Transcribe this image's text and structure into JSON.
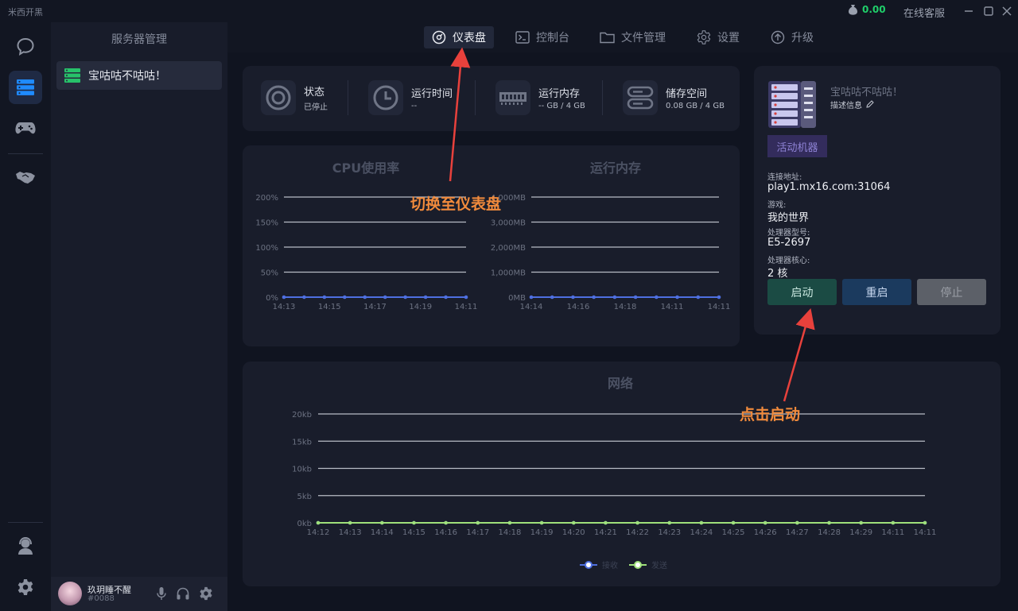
{
  "app": {
    "title": "米西开黑",
    "balance": "0.00",
    "support": "在线客服"
  },
  "sidebar": {
    "panel_title": "服务器管理",
    "server_name": "宝咕咕不咕咕！"
  },
  "user": {
    "name": "玖玥睡不醒",
    "id": "#0088"
  },
  "nav": {
    "tabs": [
      {
        "label": "仪表盘",
        "active": true
      },
      {
        "label": "控制台"
      },
      {
        "label": "文件管理"
      },
      {
        "label": "设置"
      },
      {
        "label": "升级"
      }
    ]
  },
  "stats": [
    {
      "label": "状态",
      "value": "已停止"
    },
    {
      "label": "运行时间",
      "value": "--"
    },
    {
      "label": "运行内存",
      "value": "-- GB / 4 GB"
    },
    {
      "label": "储存空间",
      "value": "0.08 GB / 4 GB"
    }
  ],
  "chart_data": [
    {
      "type": "line",
      "title": "CPU使用率",
      "x": [
        "14:13",
        "14:15",
        "14:17",
        "14:19",
        "14:11"
      ],
      "yticks": [
        "0%",
        "50%",
        "100%",
        "150%",
        "200%"
      ],
      "ylim": [
        0,
        200
      ],
      "series": [
        {
          "values": [
            0,
            0,
            0,
            0,
            0,
            0,
            0,
            0,
            0,
            0
          ],
          "color": "#4e6fe0"
        }
      ]
    },
    {
      "type": "line",
      "title": "运行内存",
      "x": [
        "14:14",
        "14:16",
        "14:18",
        "14:11",
        "14:11"
      ],
      "yticks": [
        "0MB",
        "1,000MB",
        "2,000MB",
        "3,000MB",
        "4,000MB"
      ],
      "ylim": [
        0,
        4000
      ],
      "series": [
        {
          "values": [
            0,
            0,
            0,
            0,
            0,
            0,
            0,
            0,
            0,
            0
          ],
          "color": "#4e6fe0"
        }
      ]
    },
    {
      "type": "line",
      "title": "网络",
      "x": [
        "14:12",
        "14:13",
        "14:14",
        "14:15",
        "14:16",
        "14:17",
        "14:18",
        "14:19",
        "14:20",
        "14:21",
        "14:22",
        "14:23",
        "14:24",
        "14:25",
        "14:26",
        "14:27",
        "14:28",
        "14:29",
        "14:11",
        "14:11"
      ],
      "yticks": [
        "0kb",
        "5kb",
        "10kb",
        "15kb",
        "20kb"
      ],
      "ylim": [
        0,
        20
      ],
      "series": [
        {
          "name": "接收",
          "values": [
            0,
            0,
            0,
            0,
            0,
            0,
            0,
            0,
            0,
            0,
            0,
            0,
            0,
            0,
            0,
            0,
            0,
            0,
            0,
            0
          ],
          "color": "#4e6fe0"
        },
        {
          "name": "发送",
          "values": [
            0,
            0,
            0,
            0,
            0,
            0,
            0,
            0,
            0,
            0,
            0,
            0,
            0,
            0,
            0,
            0,
            0,
            0,
            0,
            0
          ],
          "color": "#9fe07a"
        }
      ],
      "legend": "bottom-center"
    }
  ],
  "info": {
    "server_name": "宝咕咕不咕咕！",
    "desc": "描述信息",
    "active_machine": "活动机器",
    "address_label": "连接地址:",
    "address": "play1.mx16.com:31064",
    "game_label": "游戏:",
    "game": "我的世界",
    "cpu_model_label": "处理器型号:",
    "cpu_model": "E5-2697",
    "cpu_cores_label": "处理器核心:",
    "cpu_cores": "2 核",
    "start": "启动",
    "restart": "重启",
    "stop": "停止"
  },
  "annotations": {
    "dashboard": "切换至仪表盘",
    "start": "点击启动"
  },
  "colors": {
    "accent": "#1f8bff",
    "online": "#1fcf6a",
    "start_btn": "#1b4b44",
    "restart_btn": "#1b3a5e",
    "stop_btn": "#5c6068",
    "annotation": "#f08a3c"
  }
}
